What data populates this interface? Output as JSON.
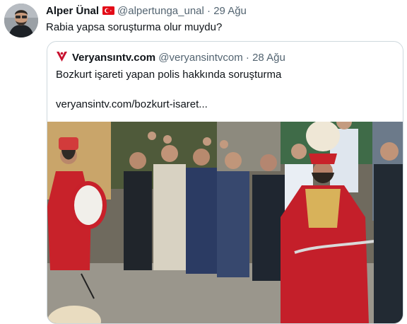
{
  "tweet": {
    "author_name": "Alper Ünal",
    "handle": "@alpertunga_unal",
    "separator": "·",
    "date": "29 Ağu",
    "text": "Rabia yapsa soruşturma olur muydu?",
    "flag_icon": "turkey-flag-icon"
  },
  "quoted": {
    "author_name": "Veryansıntv.com",
    "handle": "@veryansintvcom",
    "separator": "·",
    "date": "28 Ağu",
    "text": "Bozkurt işareti yapan polis hakkında soruşturma",
    "link": "veryansintv.com/bozkurt-isaret...",
    "brand_color": "#c8102e"
  },
  "colors": {
    "muted": "#536471",
    "border": "#cfd9de",
    "flag_red": "#e30a17"
  }
}
